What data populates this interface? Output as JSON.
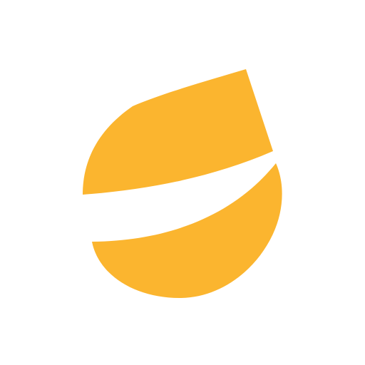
{
  "logo": {
    "icon": "yellow-drop-logo-icon",
    "color": "#FBB52F",
    "background": "#FFFFFF"
  }
}
